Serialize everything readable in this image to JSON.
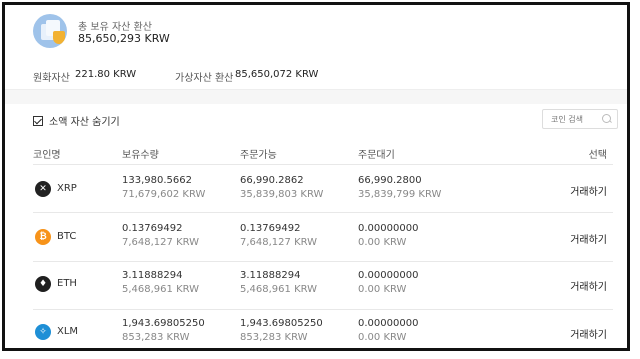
{
  "summary": {
    "title": "총 보유 자산 환산",
    "total": "85,650,293 KRW"
  },
  "sub": {
    "krw_label": "원화자산",
    "krw_value": "221.80 KRW",
    "virtual_label": "가상자산 환산",
    "virtual_value": "85,650,072 KRW"
  },
  "filter": {
    "hide_small_label": "소액 자산 숨기기",
    "hide_small_checked": true,
    "search_placeholder": "코인 검색"
  },
  "table": {
    "headers": {
      "coin": "코인명",
      "holding": "보유수량",
      "available": "주문가능",
      "pending": "주문대기",
      "select": "선택"
    },
    "rows": [
      {
        "symbol": "XRP",
        "icon": "xrp-icon",
        "icon_color": "#222222",
        "holding": "133,980.5662",
        "holding_krw": "71,679,602 KRW",
        "available": "66,990.2862",
        "available_krw": "35,839,803 KRW",
        "pending": "66,990.2800",
        "pending_krw": "35,839,799 KRW",
        "action": "거래하기"
      },
      {
        "symbol": "BTC",
        "icon": "bitcoin-icon",
        "icon_color": "#f7931a",
        "holding": "0.13769492",
        "holding_krw": "7,648,127 KRW",
        "available": "0.13769492",
        "available_krw": "7,648,127 KRW",
        "pending": "0.00000000",
        "pending_krw": "0.00 KRW",
        "action": "거래하기"
      },
      {
        "symbol": "ETH",
        "icon": "ethereum-icon",
        "icon_color": "#1f1f1f",
        "holding": "3.11888294",
        "holding_krw": "5,468,961 KRW",
        "available": "3.11888294",
        "available_krw": "5,468,961 KRW",
        "pending": "0.00000000",
        "pending_krw": "0.00 KRW",
        "action": "거래하기"
      },
      {
        "symbol": "XLM",
        "icon": "stellar-icon",
        "icon_color": "#1e8fd6",
        "holding": "1,943.69805250",
        "holding_krw": "853,283 KRW",
        "available": "1,943.69805250",
        "available_krw": "853,283 KRW",
        "pending": "0.00000000",
        "pending_krw": "0.00 KRW",
        "action": "거래하기"
      }
    ]
  }
}
